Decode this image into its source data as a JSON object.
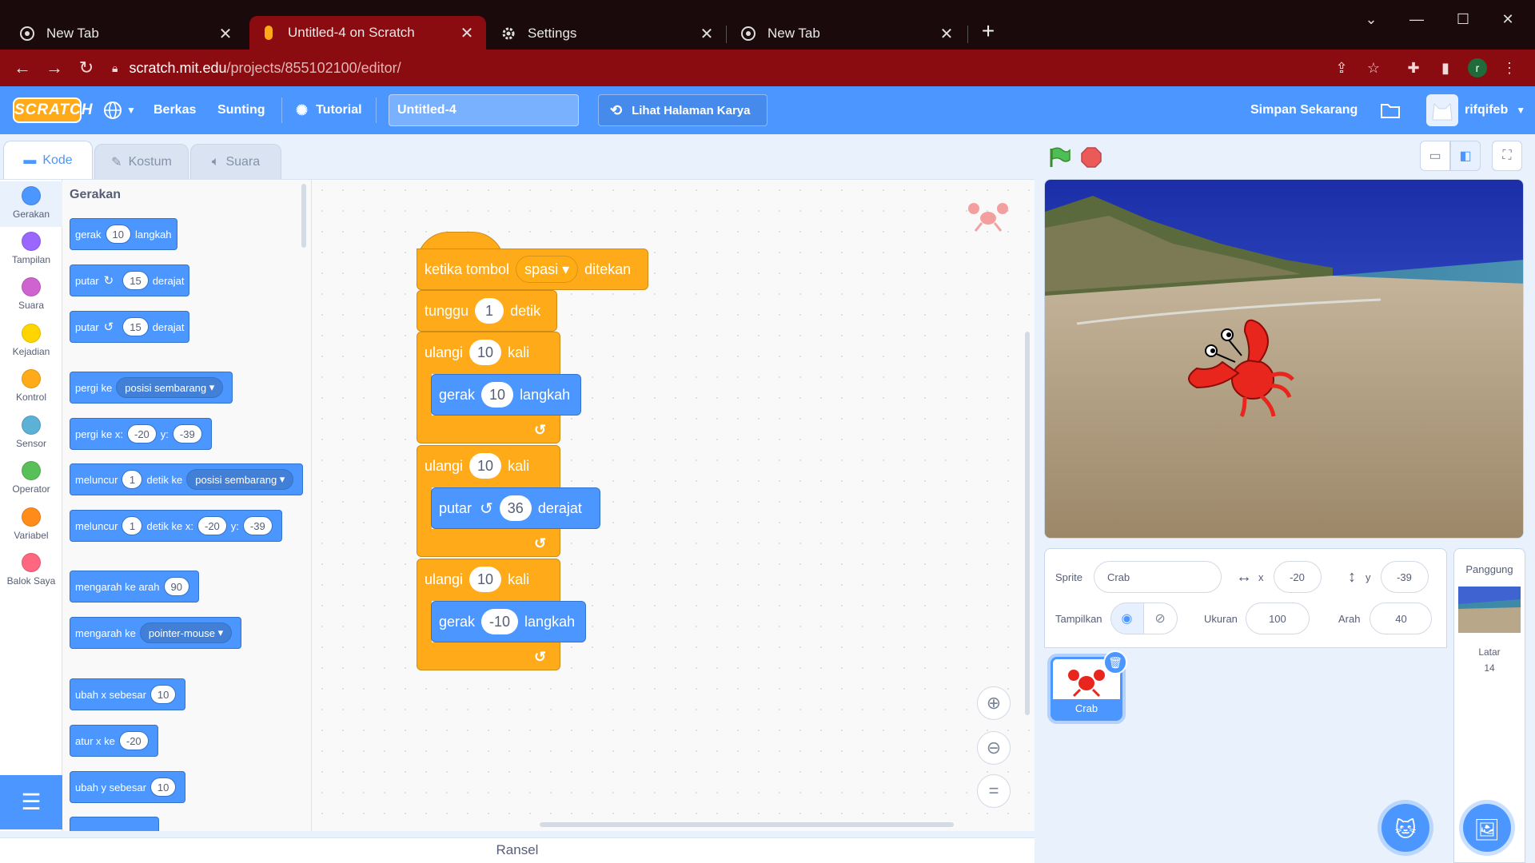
{
  "browser": {
    "tabs": [
      {
        "title": "New Tab",
        "close": "✕"
      },
      {
        "title": "Untitled-4 on Scratch",
        "close": "✕"
      },
      {
        "title": "Settings",
        "close": "✕"
      },
      {
        "title": "New Tab",
        "close": "✕"
      }
    ],
    "new_tab": "+",
    "address": {
      "host": "scratch.mit.edu",
      "path": "/projects/855102100/editor/"
    },
    "profile_initial": "r",
    "colors": {
      "chrome_bg": "#8b0c10",
      "tabstrip_bg": "#1a0a0c"
    }
  },
  "menubar": {
    "logo": "SCRATCH",
    "items": {
      "file": "Berkas",
      "edit": "Sunting",
      "tutorial": "Tutorial"
    },
    "project_title": "Untitled-4",
    "see_project_page": "Lihat Halaman Karya",
    "save_now": "Simpan Sekarang",
    "username": "rifqifeb"
  },
  "editor_tabs": {
    "code": "Kode",
    "costumes": "Kostum",
    "sounds": "Suara"
  },
  "categories": [
    {
      "label": "Gerakan",
      "color": "#4c97ff"
    },
    {
      "label": "Tampilan",
      "color": "#9966ff"
    },
    {
      "label": "Suara",
      "color": "#cf63cf"
    },
    {
      "label": "Kejadian",
      "color": "#ffd500"
    },
    {
      "label": "Kontrol",
      "color": "#ffab19"
    },
    {
      "label": "Sensor",
      "color": "#5cb1d6"
    },
    {
      "label": "Operator",
      "color": "#59c059"
    },
    {
      "label": "Variabel",
      "color": "#ff8c1a"
    },
    {
      "label": "Balok Saya",
      "color": "#ff6680"
    }
  ],
  "palette": {
    "heading": "Gerakan",
    "blocks": {
      "move": {
        "t1": "gerak",
        "v1": "10",
        "t2": "langkah"
      },
      "turn_right": {
        "t1": "putar",
        "v1": "15",
        "t2": "derajat"
      },
      "turn_left": {
        "t1": "putar",
        "v1": "15",
        "t2": "derajat"
      },
      "goto": {
        "t1": "pergi ke",
        "dd": "posisi sembarang"
      },
      "goto_xy": {
        "t1": "pergi ke x:",
        "v1": "-20",
        "t2": "y:",
        "v2": "-39"
      },
      "glide": {
        "t1": "meluncur",
        "v1": "1",
        "t2": "detik ke",
        "dd": "posisi sembarang"
      },
      "glide_xy": {
        "t1": "meluncur",
        "v1": "1",
        "t2": "detik ke x:",
        "v2": "-20",
        "t3": "y:",
        "v3": "-39"
      },
      "point_dir": {
        "t1": "mengarah ke arah",
        "v1": "90"
      },
      "point_towards": {
        "t1": "mengarah ke",
        "dd": "pointer-mouse"
      },
      "change_x": {
        "t1": "ubah x sebesar",
        "v1": "10"
      },
      "set_x": {
        "t1": "atur x ke",
        "v1": "-20"
      },
      "change_y": {
        "t1": "ubah y sebesar",
        "v1": "10"
      }
    }
  },
  "script": {
    "hat": {
      "t1": "ketika tombol",
      "dd": "spasi",
      "t2": "ditekan"
    },
    "wait": {
      "t1": "tunggu",
      "v1": "1",
      "t2": "detik"
    },
    "loop1": {
      "t1": "ulangi",
      "v1": "10",
      "t2": "kali"
    },
    "move1": {
      "t1": "gerak",
      "v1": "10",
      "t2": "langkah"
    },
    "loop2": {
      "t1": "ulangi",
      "v1": "10",
      "t2": "kali"
    },
    "turn": {
      "t1": "putar",
      "v1": "36",
      "t2": "derajat"
    },
    "loop3": {
      "t1": "ulangi",
      "v1": "10",
      "t2": "kali"
    },
    "move2": {
      "t1": "gerak",
      "v1": "-10",
      "t2": "langkah"
    }
  },
  "backpack": "Ransel",
  "sprite_info": {
    "sprite_label": "Sprite",
    "sprite_name": "Crab",
    "x_label": "x",
    "x_value": "-20",
    "y_label": "y",
    "y_value": "-39",
    "show_label": "Tampilkan",
    "size_label": "Ukuran",
    "size_value": "100",
    "direction_label": "Arah",
    "direction_value": "40"
  },
  "sprites": [
    {
      "name": "Crab"
    }
  ],
  "stage_panel": {
    "title": "Panggung",
    "backdrops_label": "Latar",
    "backdrops_count": "14"
  }
}
